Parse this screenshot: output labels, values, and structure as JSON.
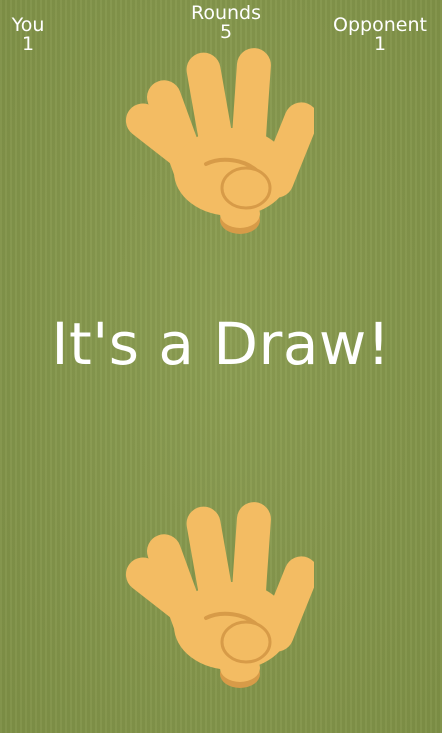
{
  "scoreboard": {
    "you": {
      "label": "You",
      "value": "1"
    },
    "rounds": {
      "label": "Rounds",
      "value": "5"
    },
    "opponent": {
      "label": "Opponent",
      "value": "1"
    }
  },
  "result_text": "It's a Draw!",
  "opponent_move": {
    "icon": "open-hand-paper-icon"
  },
  "player_move": {
    "icon": "open-hand-paper-icon"
  },
  "colors": {
    "background": "#86994a",
    "hand_fill": "#f3bc63",
    "hand_shadow": "#d79b48",
    "text": "#ffffff"
  }
}
